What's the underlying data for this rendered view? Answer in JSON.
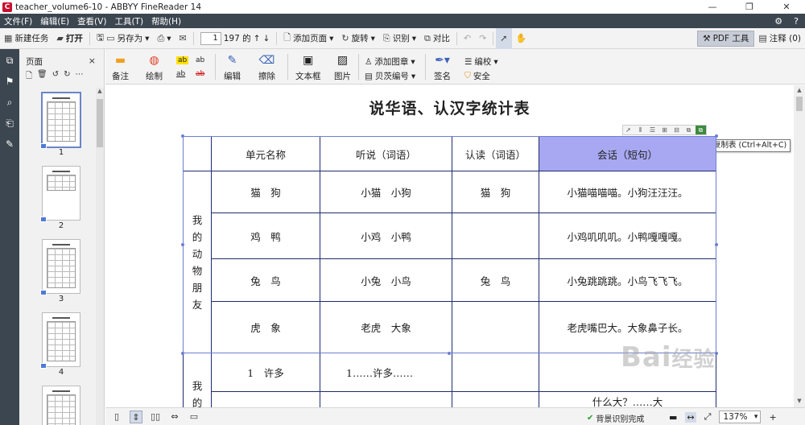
{
  "window": {
    "title": "teacher_volume6-10 - ABBYY FineReader 14",
    "logo_letter": "C",
    "controls": [
      "—",
      "❐",
      "✕"
    ]
  },
  "menu": {
    "items": [
      "文件(F)",
      "编辑(E)",
      "查看(V)",
      "工具(T)",
      "帮助(H)"
    ],
    "settings_icon": "⚙",
    "help_icon": "?"
  },
  "toolbar": {
    "new_task": "新建任务",
    "open": "打开",
    "save_as": "另存为",
    "current_page": "1",
    "total_pages": "197 的",
    "add_page": "添加页面",
    "rotate": "旋转",
    "recognize": "识别",
    "compare": "对比",
    "pdf_tools": "PDF 工具",
    "annotations": "注释 (0)"
  },
  "panel": {
    "title": "页面",
    "close": "×",
    "thumb_numbers": [
      "1",
      "2",
      "3",
      "4"
    ]
  },
  "ribbon": {
    "note": "备注",
    "draw": "绘制",
    "edit": "编辑",
    "erase": "擦除",
    "textbox": "文本框",
    "image": "图片",
    "add_shape": "添加图章",
    "bates": "贝茨编号",
    "sign": "签名",
    "redact": "编校",
    "security": "安全",
    "hl_text": "ab"
  },
  "document": {
    "title": "说华语、认汉字统计表",
    "headers": [
      "单元名称",
      "听说（词语）",
      "认读（词语）",
      "会话（短句）"
    ],
    "group1": {
      "label": [
        "我",
        "的",
        "动",
        "物",
        "朋",
        "友"
      ],
      "rows": [
        [
          "猫　狗",
          "小猫　小狗",
          "猫　狗",
          "小猫喵喵喵。小狗汪汪汪。"
        ],
        [
          "鸡　鸭",
          "小鸡　小鸭",
          "",
          "小鸡叽叽叽。小鸭嘎嘎嘎。"
        ],
        [
          "兔　鸟",
          "小兔　小鸟",
          "兔　鸟",
          "小兔跳跳跳。小鸟飞飞飞。"
        ],
        [
          "虎　象",
          "老虎　大象",
          "",
          "老虎嘴巴大。大象鼻子长。"
        ]
      ]
    },
    "group2": {
      "label": [
        "我",
        "的"
      ],
      "rows": [
        [
          "1　许多",
          "1……许多……",
          "",
          ""
        ],
        [
          "",
          "",
          "",
          "什么大？……大"
        ]
      ]
    },
    "tooltip": "复制表 (Ctrl+Alt+C)",
    "watermark": "Bai",
    "watermark_cn": "经验"
  },
  "status": {
    "bg_recognition": "背景识别完成",
    "zoom": "137%"
  }
}
